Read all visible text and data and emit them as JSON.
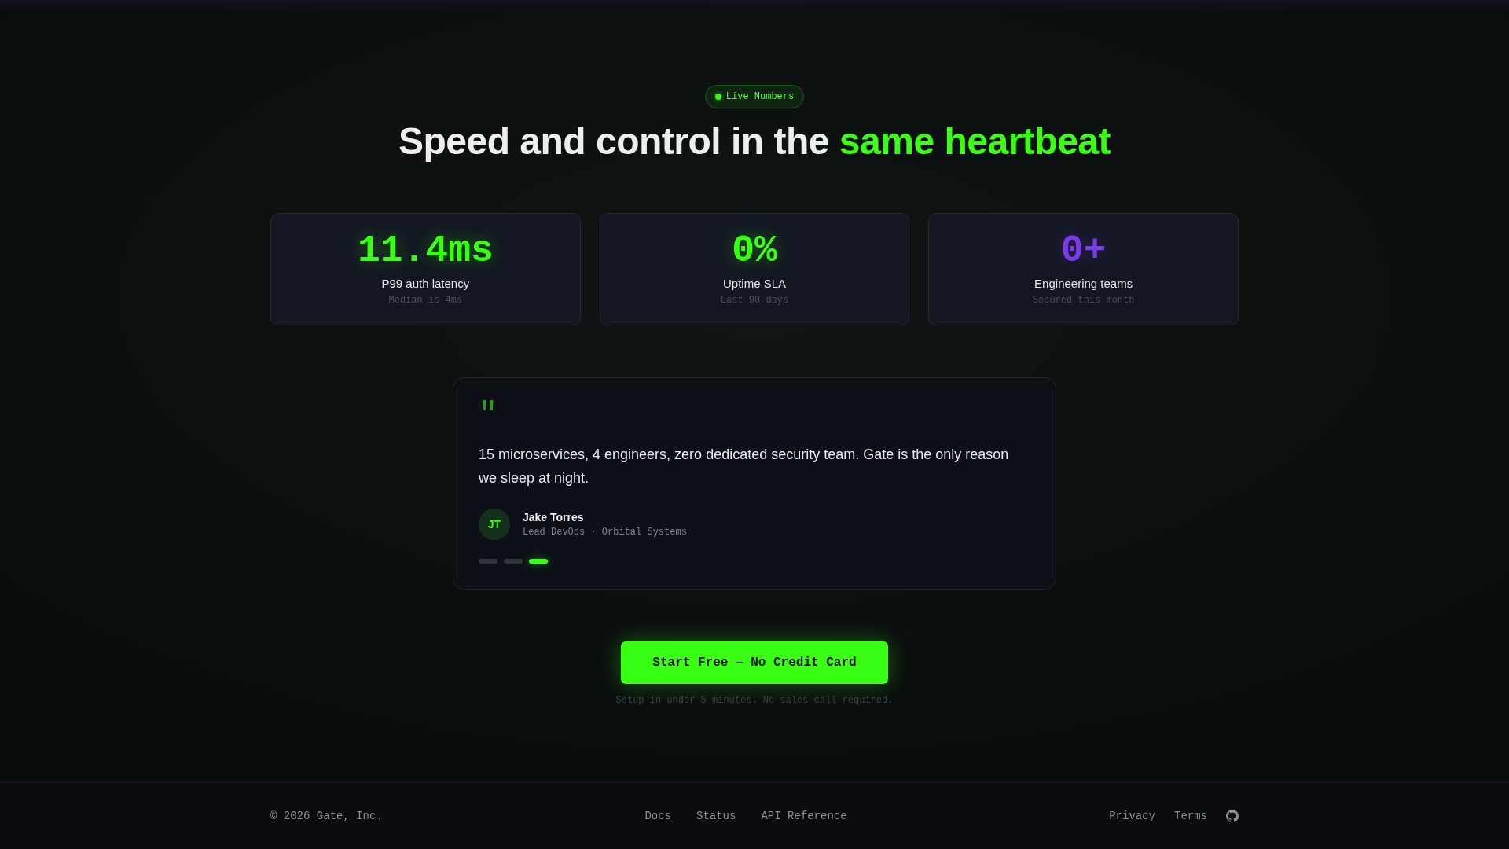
{
  "badge": {
    "label": "Live Numbers"
  },
  "heading": {
    "text": "Speed and control in the",
    "highlight": "same heartbeat"
  },
  "stats": [
    {
      "value": "11.4ms",
      "label": "P99 auth latency",
      "note": "Median is 4ms",
      "color": "#39ff14"
    },
    {
      "value": "0%",
      "label": "Uptime SLA",
      "note": "Last 90 days",
      "color": "#39ff14"
    },
    {
      "value": "0+",
      "label": "Engineering teams",
      "note": "Secured this month",
      "color": "#7c3aed"
    }
  ],
  "testimonial": {
    "quote_mark": "\"",
    "quote": "15 microservices, 4 engineers, zero dedicated security team. Gate is the only reason we sleep at night.",
    "author": {
      "initials": "JT",
      "name": "Jake Torres",
      "role": "Lead DevOps · Orbital Systems"
    },
    "slides": [
      {
        "selected": false
      },
      {
        "selected": false
      },
      {
        "selected": true
      }
    ]
  },
  "cta": {
    "button": "Start Free — No Credit Card",
    "note": "Setup in under 5 minutes. No sales call required."
  },
  "footer": {
    "copyright": "© 2026 Gate, Inc.",
    "links": [
      "Docs",
      "Status",
      "API Reference"
    ],
    "legal_links": [
      "Privacy",
      "Terms"
    ]
  }
}
